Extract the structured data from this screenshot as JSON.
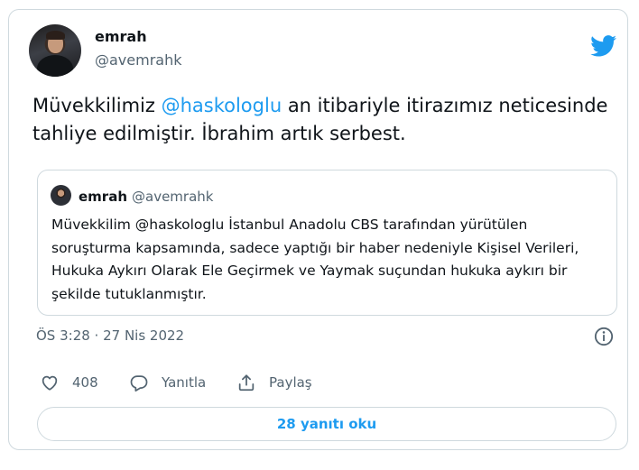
{
  "tweet": {
    "author_name": "emrah",
    "author_handle": "@avemrahk",
    "text_before": "Müvekkilimiz ",
    "mention": "@haskologlu",
    "text_after": " an itibariyle itirazımız neticesinde tahliye edilmiştir. İbrahim artık serbest.",
    "timestamp": "ÖS 3:28 · 27 Nis 2022"
  },
  "quoted_tweet": {
    "author_name": "emrah",
    "author_handle": "@avemrahk",
    "text": "Müvekkilim @haskologlu İstanbul Anadolu CBS tarafından yürütülen soruşturma kapsamında, sadece yaptığı bir haber nedeniyle Kişisel Verileri, Hukuka Aykırı Olarak Ele Geçirmek ve Yaymak suçundan hukuka aykırı bir şekilde tutuklanmıştır."
  },
  "actions": {
    "like_count": "408",
    "reply_label": "Yanıtla",
    "share_label": "Paylaş"
  },
  "read_replies_label": "28 yanıtı oku",
  "colors": {
    "accent": "#1d9bf0",
    "secondary_text": "#536471",
    "border": "#cfd9de"
  },
  "icons": [
    "twitter-bird-icon",
    "info-icon",
    "heart-icon",
    "reply-icon",
    "share-icon"
  ]
}
